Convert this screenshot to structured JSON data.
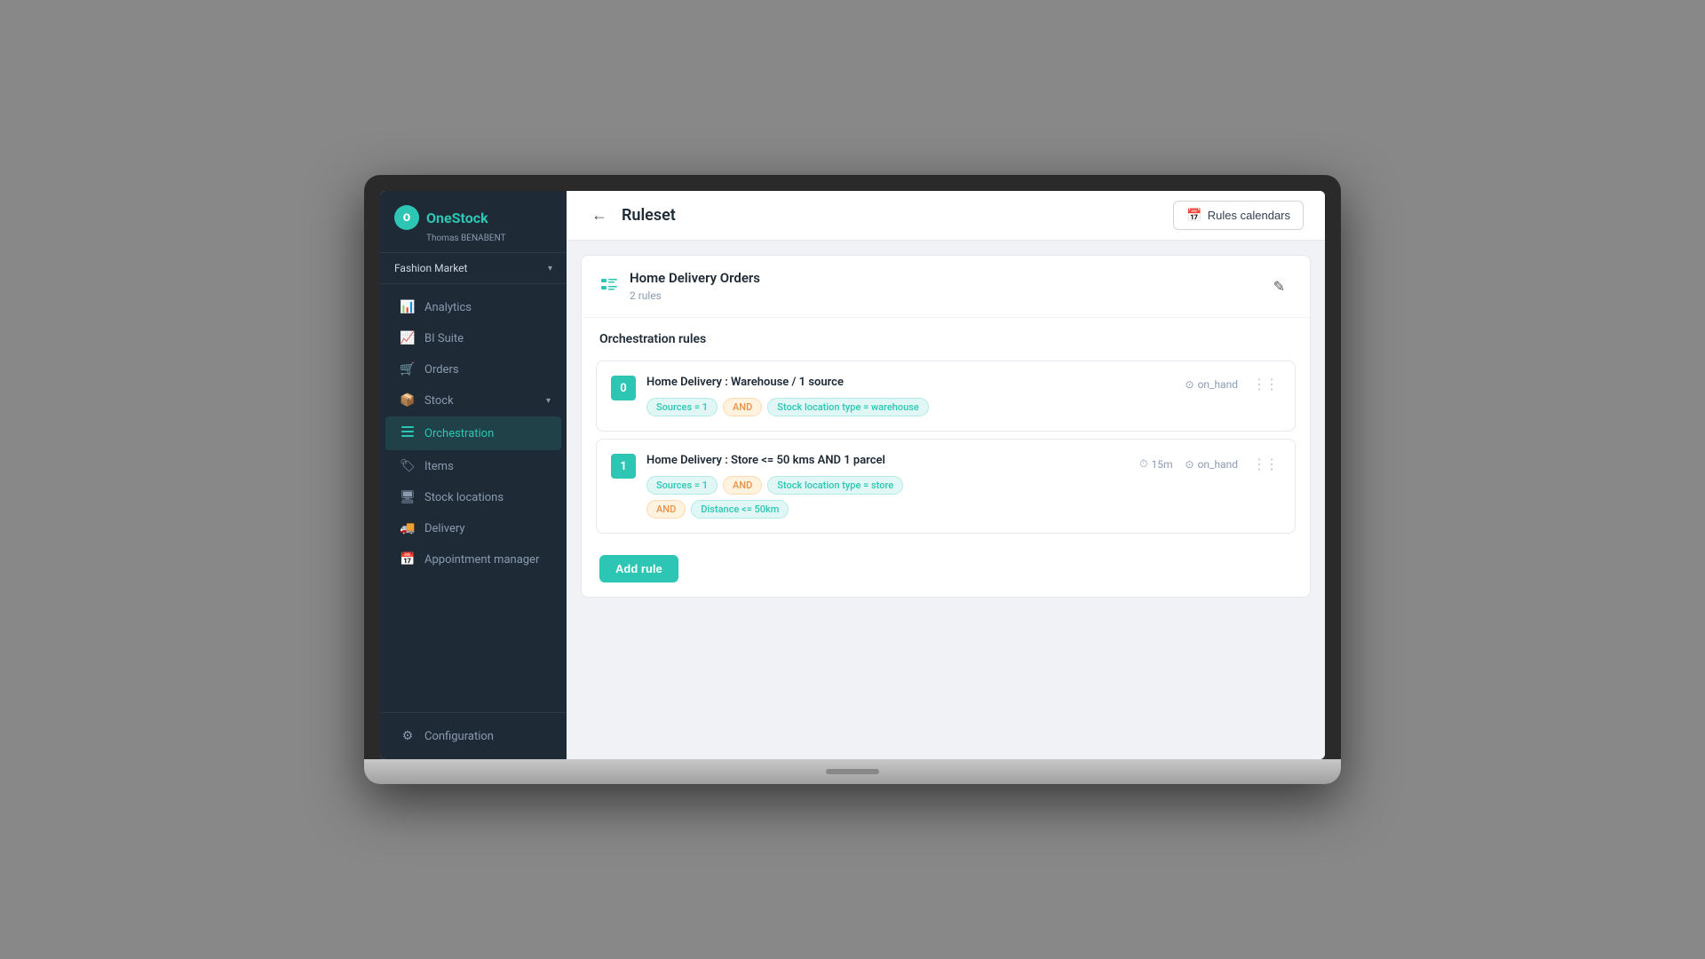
{
  "brand": {
    "logo_text": "O",
    "name_part1": "One",
    "name_part2": "Stock",
    "user": "Thomas BENABENT",
    "store": "Fashion Market"
  },
  "sidebar": {
    "items": [
      {
        "id": "analytics",
        "label": "Analytics",
        "icon": "📊"
      },
      {
        "id": "bi-suite",
        "label": "BI Suite",
        "icon": "📈"
      },
      {
        "id": "orders",
        "label": "Orders",
        "icon": "🛒"
      },
      {
        "id": "stock",
        "label": "Stock",
        "icon": "📦",
        "hasArrow": true
      },
      {
        "id": "orchestration",
        "label": "Orchestration",
        "icon": "≡",
        "active": true
      },
      {
        "id": "items",
        "label": "Items",
        "icon": "🏷"
      },
      {
        "id": "stock-locations",
        "label": "Stock locations",
        "icon": "🖥"
      },
      {
        "id": "delivery",
        "label": "Delivery",
        "icon": "🚚"
      },
      {
        "id": "appointment-manager",
        "label": "Appointment manager",
        "icon": "📅"
      }
    ],
    "bottom_items": [
      {
        "id": "configuration",
        "label": "Configuration",
        "icon": "⚙"
      }
    ]
  },
  "topbar": {
    "page_title": "Ruleset",
    "rules_calendars_btn": "Rules calendars"
  },
  "ruleset": {
    "icon": "≡",
    "title": "Home Delivery Orders",
    "subtitle": "2 rules",
    "section_title": "Orchestration rules",
    "rules": [
      {
        "number": "0",
        "title": "Home Delivery : Warehouse / 1 source",
        "tags_row1": [
          {
            "label": "Sources = 1",
            "type": "teal"
          },
          {
            "label": "AND",
            "type": "orange"
          },
          {
            "label": "Stock location type = warehouse",
            "type": "teal"
          }
        ],
        "meta": [
          {
            "icon": "⊙",
            "text": "on_hand"
          }
        ]
      },
      {
        "number": "1",
        "title": "Home Delivery : Store <= 50 kms AND 1 parcel",
        "tags_row1": [
          {
            "label": "Sources = 1",
            "type": "teal"
          },
          {
            "label": "AND",
            "type": "orange"
          },
          {
            "label": "Stock location type = store",
            "type": "teal"
          }
        ],
        "tags_row2": [
          {
            "label": "AND",
            "type": "orange"
          },
          {
            "label": "Distance <= 50km",
            "type": "teal"
          }
        ],
        "meta": [
          {
            "icon": "⏱",
            "text": "15m"
          },
          {
            "icon": "⊙",
            "text": "on_hand"
          }
        ]
      }
    ],
    "add_rule_label": "Add rule"
  }
}
